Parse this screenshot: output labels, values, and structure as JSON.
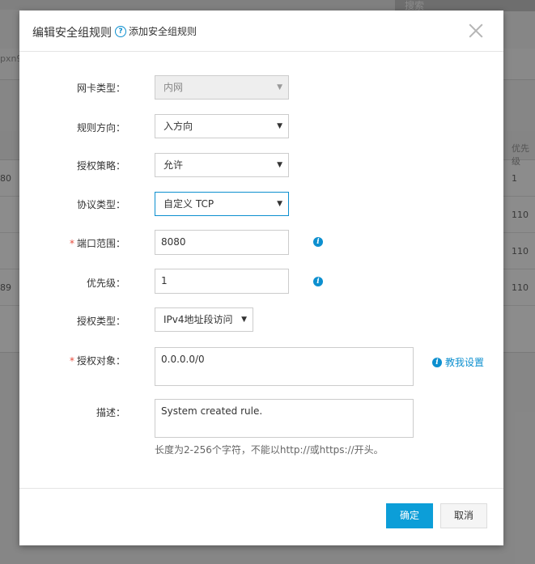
{
  "background": {
    "search_label": "搜索",
    "instance_id_fragment": "pxn9",
    "column_priority": "优先级",
    "rows": [
      {
        "left": "80",
        "priority": "1"
      },
      {
        "left": "",
        "priority": "110"
      },
      {
        "left": "",
        "priority": "110"
      },
      {
        "left": "89",
        "priority": "110"
      }
    ]
  },
  "dialog": {
    "title": "编辑安全组规则",
    "help_link": "添加安全组规则",
    "fields": {
      "nic_type": {
        "label": "网卡类型：",
        "value": "内网"
      },
      "direction": {
        "label": "规则方向：",
        "value": "入方向"
      },
      "policy": {
        "label": "授权策略：",
        "value": "允许"
      },
      "protocol": {
        "label": "协议类型：",
        "value": "自定义 TCP"
      },
      "port_range": {
        "label": "端口范围：",
        "value": "8080"
      },
      "priority": {
        "label": "优先级：",
        "value": "1"
      },
      "auth_type": {
        "label": "授权类型：",
        "value": "IPv4地址段访问"
      },
      "auth_object": {
        "label": "授权对象：",
        "value": "0.0.0.0/0"
      },
      "description": {
        "label": "描述：",
        "value": "System created rule."
      }
    },
    "required_mark": "*",
    "teach_link": "教我设置",
    "description_hint": "长度为2-256个字符，不能以http://或https://开头。",
    "ok_button": "确定",
    "cancel_button": "取消"
  },
  "colors": {
    "accent": "#0c9ed8",
    "required": "#e74c3c"
  }
}
